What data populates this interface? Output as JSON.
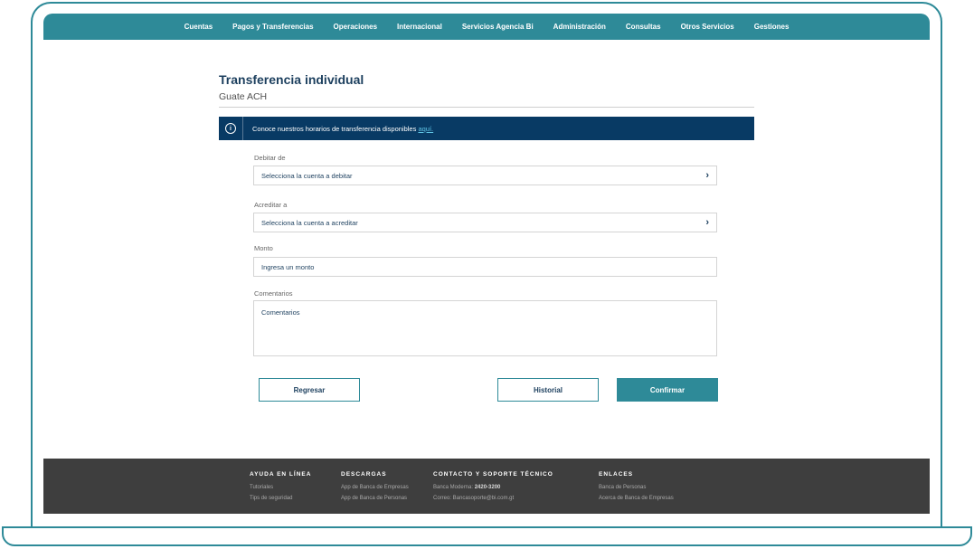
{
  "nav": {
    "items": [
      "Cuentas",
      "Pagos y Transferencias",
      "Operaciones",
      "Internacional",
      "Servicios Agencia Bi",
      "Administración",
      "Consultas",
      "Otros Servicios",
      "Gestiones"
    ]
  },
  "page": {
    "title": "Transferencia individual",
    "subtitle": "Guate ACH"
  },
  "banner": {
    "text": "Conoce nuestros horarios de transferencia disponibles",
    "link": "aquí."
  },
  "form": {
    "debit_label": "Debitar de",
    "debit_placeholder": "Selecciona la cuenta a debitar",
    "credit_label": "Acreditar a",
    "credit_placeholder": "Selecciona la cuenta a acreditar",
    "amount_label": "Monto",
    "amount_placeholder": "Ingresa un monto",
    "comments_label": "Comentarios",
    "comments_placeholder": "Comentarios"
  },
  "buttons": {
    "back": "Regresar",
    "history": "Historial",
    "confirm": "Confirmar"
  },
  "footer": {
    "help_title": "AYUDA EN LÍNEA",
    "help_links": [
      "Tutoriales",
      "Tips de seguridad"
    ],
    "downloads_title": "DESCARGAS",
    "downloads_links": [
      "App de Banca de Empresas",
      "App de Banca de Personas"
    ],
    "contact_title": "CONTACTO Y SOPORTE TÉCNICO",
    "contact_phone_label": "Banca Moderna:",
    "contact_phone": "2420-3200",
    "contact_email": "Correo: Bancasoporte@bi.com.gt",
    "links_title": "ENLACES",
    "links": [
      "Banca de Personas",
      "Acerca de Banca de Empresas"
    ]
  },
  "colors": {
    "brand_teal": "#2e8a98",
    "banner_navy": "#083a64",
    "footer_gray": "#3e3e3e"
  }
}
